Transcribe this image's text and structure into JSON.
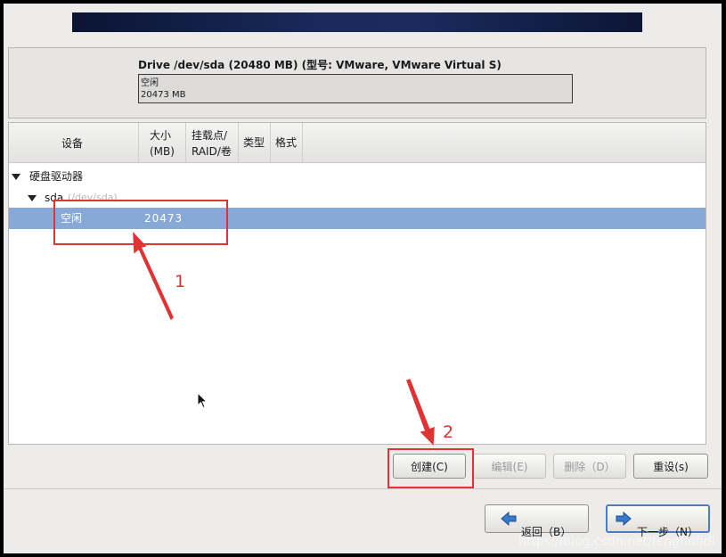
{
  "drive": {
    "title": "Drive /dev/sda (20480 MB) (型号: VMware, VMware Virtual S)",
    "bar_label": "空闲",
    "bar_size": "20473 MB"
  },
  "table": {
    "headers": {
      "device": "设备",
      "size": "大小\n(MB)",
      "mount": "挂载点/\nRAID/卷",
      "type": "类型",
      "format": "格式"
    },
    "rows": {
      "hard_drives": "硬盘驱动器",
      "sda": "sda",
      "sda_path": "(/dev/sda)",
      "free_device": "空闲",
      "free_size": "20473"
    }
  },
  "buttons": {
    "create": "创建(C)",
    "edit": "编辑(E)",
    "delete": "删除（D）",
    "reset": "重设(s)"
  },
  "nav": {
    "back": "返回（B）",
    "next": "下一步（N）"
  },
  "annotations": {
    "step1": "1",
    "step2": "2",
    "color": "#e03333"
  },
  "watermark": "https://blog.csdn.net/fengfidfidi",
  "colors": {
    "selection": "#86a9d7",
    "banner": "#1a2a5c"
  }
}
